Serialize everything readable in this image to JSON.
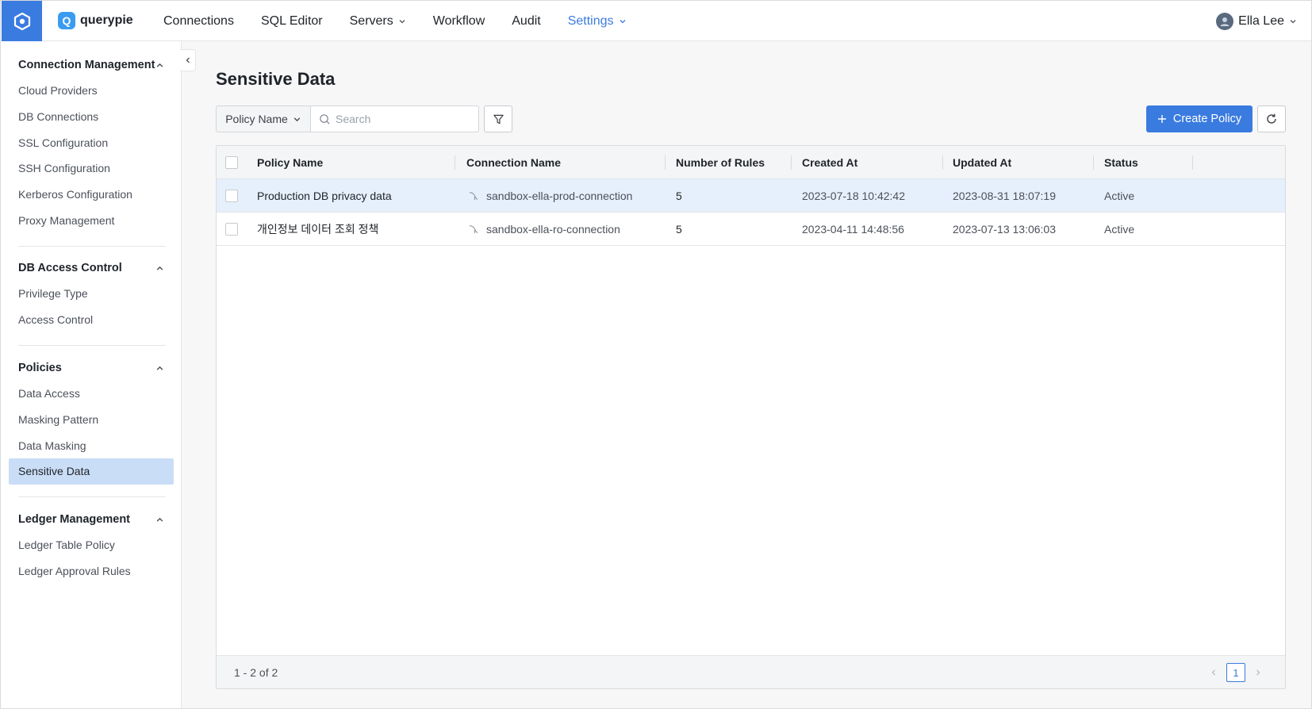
{
  "app": {
    "brand_name": "querypie",
    "brand_letter": "Q",
    "colors": {
      "primary": "#3a7be0",
      "selected_row": "#e6f0fc",
      "active_nav": "#c9ddf6"
    }
  },
  "nav": {
    "items": [
      {
        "label": "Connections"
      },
      {
        "label": "SQL Editor"
      },
      {
        "label": "Servers",
        "has_dropdown": true
      },
      {
        "label": "Workflow"
      },
      {
        "label": "Audit"
      },
      {
        "label": "Settings",
        "has_dropdown": true,
        "active": true
      }
    ],
    "user_name": "Ella Lee"
  },
  "sidebar": {
    "sections": [
      {
        "title": "Connection Management",
        "items": [
          "Cloud Providers",
          "DB Connections",
          "SSL Configuration",
          "SSH Configuration",
          "Kerberos Configuration",
          "Proxy Management"
        ]
      },
      {
        "title": "DB Access Control",
        "items": [
          "Privilege Type",
          "Access Control"
        ]
      },
      {
        "title": "Policies",
        "items": [
          "Data Access",
          "Masking Pattern",
          "Data Masking",
          "Sensitive Data"
        ],
        "active_item": "Sensitive Data"
      },
      {
        "title": "Ledger Management",
        "items": [
          "Ledger Table Policy",
          "Ledger Approval Rules"
        ]
      }
    ]
  },
  "main": {
    "title": "Sensitive Data",
    "filter_field": "Policy Name",
    "search_placeholder": "Search",
    "create_button": "Create Policy",
    "columns": [
      "Policy Name",
      "Connection Name",
      "Number of Rules",
      "Created At",
      "Updated At",
      "Status"
    ],
    "rows": [
      {
        "policy_name": "Production DB privacy data",
        "connection_name": "sandbox-ella-prod-connection",
        "rules": "5",
        "created_at": "2023-07-18 10:42:42",
        "updated_at": "2023-08-31 18:07:19",
        "status": "Active",
        "selected": true
      },
      {
        "policy_name": "개인정보 데이터 조회 정책",
        "connection_name": "sandbox-ella-ro-connection",
        "rules": "5",
        "created_at": "2023-04-11 14:48:56",
        "updated_at": "2023-07-13 13:06:03",
        "status": "Active",
        "selected": false
      }
    ],
    "pagination": {
      "range_text": "1 - 2 of 2",
      "current_page": "1"
    }
  }
}
